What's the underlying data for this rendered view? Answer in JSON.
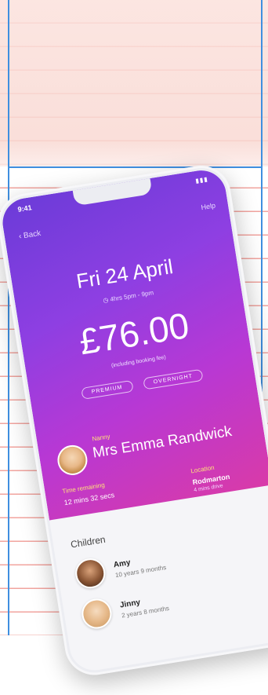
{
  "status": {
    "time": "9:41",
    "icons": "▮▮▮"
  },
  "nav": {
    "back_label": "Back",
    "right_link": "Help"
  },
  "booking": {
    "date": "Fri 24 April",
    "time_range": "4hrs  5pm - 9pm",
    "price": "£76.00",
    "price_note": "(including booking fee)",
    "chips": [
      "PREMIUM",
      "OVERNIGHT"
    ]
  },
  "nanny": {
    "label": "Nanny",
    "name": "Mrs Emma Randwick"
  },
  "stats": {
    "left_label": "Time remaining",
    "left_value": "12 mins 32 secs",
    "right_label": "Location",
    "right_value": "Rodmarton",
    "right_sub": "4 mins drive"
  },
  "children": {
    "title": "Children",
    "items": [
      {
        "name": "Amy",
        "age": "10 years 9 months"
      },
      {
        "name": "Jinny",
        "age": "2 years 8 months"
      }
    ]
  },
  "colors": {
    "hero_start": "#6b3bd8",
    "hero_end": "#d93aa8",
    "accent_label": "#ffe27a",
    "paper_line": "#e65a50",
    "margin_line": "#3f8fe0"
  }
}
